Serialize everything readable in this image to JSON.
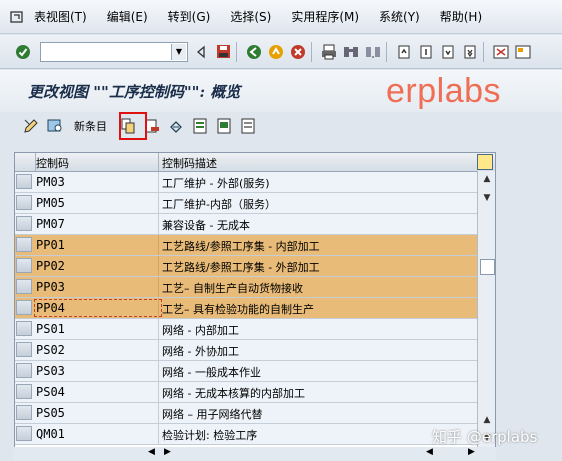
{
  "menu": {
    "items": [
      "表视图(T)",
      "编辑(E)",
      "转到(G)",
      "选择(S)",
      "实用程序(M)",
      "系统(Y)",
      "帮助(H)"
    ]
  },
  "toolbar": {
    "command_value": ""
  },
  "screen": {
    "title": "更改视图 \"\"工序控制码\"\": 概览"
  },
  "app_toolbar": {
    "new_entries_label": "新条目"
  },
  "table": {
    "headers": [
      "控制码",
      "控制码描述"
    ],
    "rows": [
      {
        "code": "PM03",
        "desc": "工厂维护 - 外部(服务)",
        "selected": false
      },
      {
        "code": "PM05",
        "desc": "工厂维护-内部（服务）",
        "selected": false
      },
      {
        "code": "PM07",
        "desc": "兼容设备 - 无成本",
        "selected": false
      },
      {
        "code": "PP01",
        "desc": "工艺路线/参照工序集 - 内部加工",
        "selected": true
      },
      {
        "code": "PP02",
        "desc": "工艺路线/参照工序集 - 外部加工",
        "selected": true
      },
      {
        "code": "PP03",
        "desc": "工艺– 自制生产自动货物接收",
        "selected": true
      },
      {
        "code": "PP04",
        "desc": "工艺– 具有检验功能的自制生产",
        "selected": true
      },
      {
        "code": "PS01",
        "desc": "网络 - 内部加工",
        "selected": false
      },
      {
        "code": "PS02",
        "desc": "网络 - 外协加工",
        "selected": false
      },
      {
        "code": "PS03",
        "desc": "网络 - 一般成本作业",
        "selected": false
      },
      {
        "code": "PS04",
        "desc": "网络 - 无成本核算的内部加工",
        "selected": false
      },
      {
        "code": "PS05",
        "desc": "网络 – 用子网络代替",
        "selected": false
      },
      {
        "code": "QM01",
        "desc": "检验计划: 检验工序",
        "selected": false
      }
    ]
  },
  "watermark": {
    "top": "erplabs",
    "bottom": "知乎 @erplabs"
  },
  "colors": {
    "selected_row": "#e8bb78",
    "highlight_box": "#e01010",
    "watermark": "#ef6e55"
  }
}
